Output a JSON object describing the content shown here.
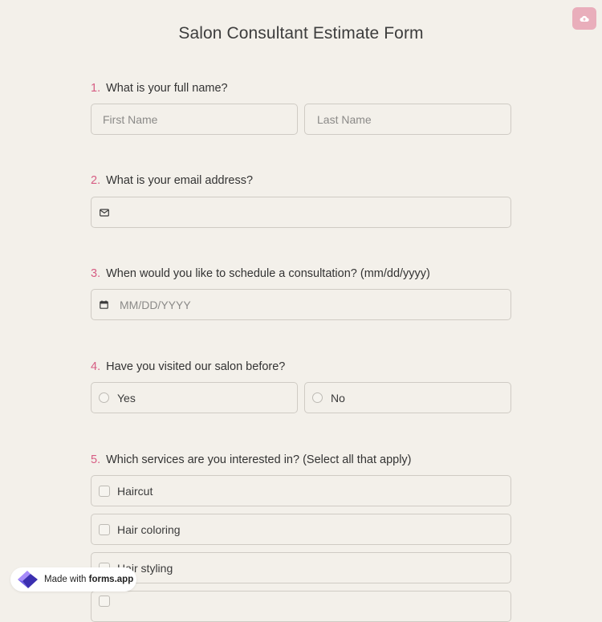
{
  "form": {
    "title": "Salon Consultant Estimate Form"
  },
  "colors": {
    "background": "#f3f0ea",
    "accent": "#d65c83",
    "corner_button": "#e9aebb"
  },
  "questions": [
    {
      "number": "1.",
      "label": "What is your full name?",
      "first_name_placeholder": "First Name",
      "last_name_placeholder": "Last Name"
    },
    {
      "number": "2.",
      "label": "What is your email address?",
      "icon": "mail-icon"
    },
    {
      "number": "3.",
      "label": "When would you like to schedule a consultation? (mm/dd/yyyy)",
      "placeholder": "MM/DD/YYYY",
      "icon": "calendar-icon"
    },
    {
      "number": "4.",
      "label": "Have you visited our salon before?",
      "options": [
        "Yes",
        "No"
      ]
    },
    {
      "number": "5.",
      "label": "Which services are you interested in? (Select all that apply)",
      "options": [
        "Haircut",
        "Hair coloring",
        "Hair styling"
      ]
    }
  ],
  "badge": {
    "prefix": "Made with",
    "brand": "forms.app"
  }
}
